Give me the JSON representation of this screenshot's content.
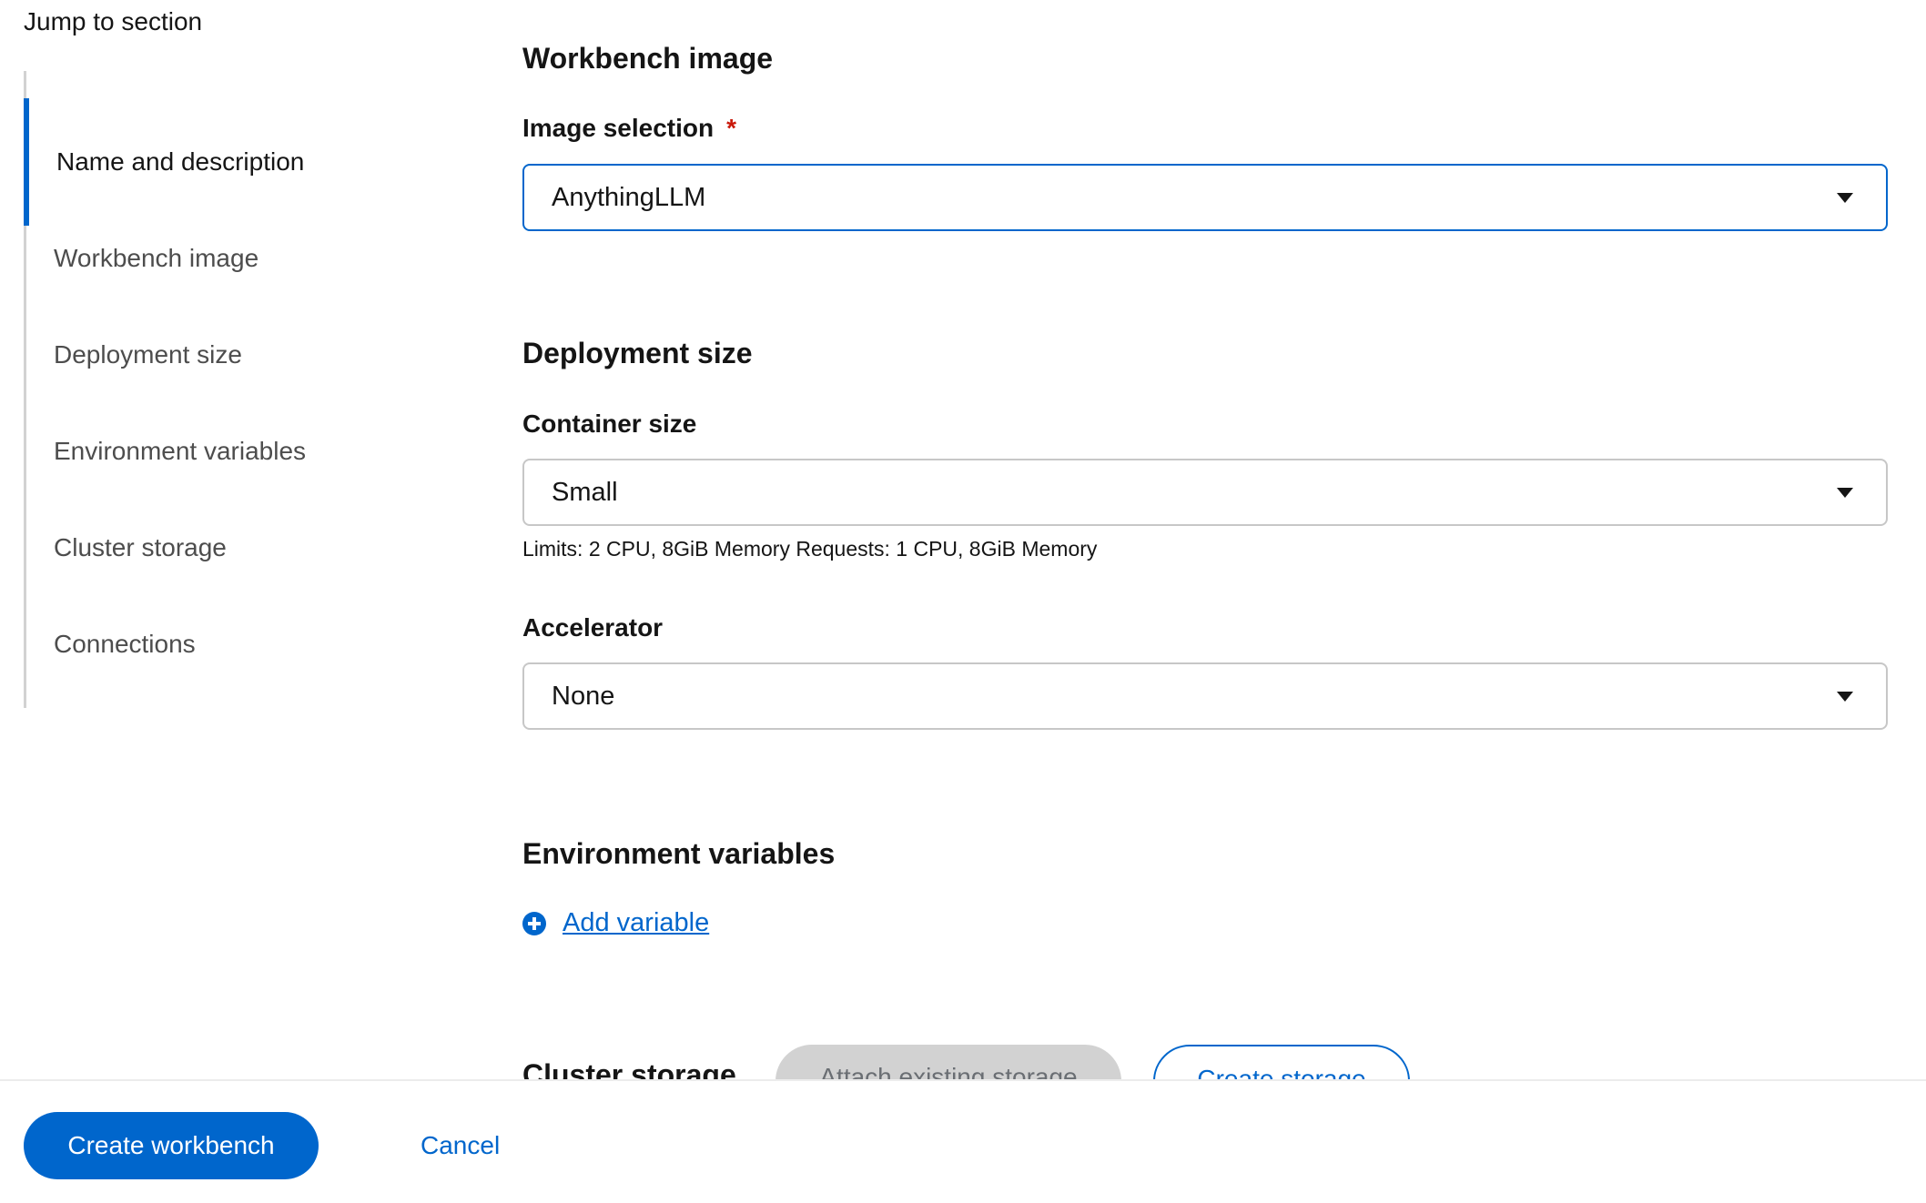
{
  "jump": {
    "title": "Jump to section",
    "items": [
      {
        "label": "Name and description",
        "active": true
      },
      {
        "label": "Workbench image"
      },
      {
        "label": "Deployment size"
      },
      {
        "label": "Environment variables"
      },
      {
        "label": "Cluster storage"
      },
      {
        "label": "Connections"
      }
    ]
  },
  "workbench_image": {
    "title": "Workbench image",
    "image_label": "Image selection",
    "required_marker": "*",
    "image_value": "AnythingLLM"
  },
  "deployment": {
    "title": "Deployment size",
    "container_label": "Container size",
    "container_value": "Small",
    "container_helper": "Limits: 2 CPU, 8GiB Memory Requests: 1 CPU, 8GiB Memory",
    "accelerator_label": "Accelerator",
    "accelerator_value": "None"
  },
  "env": {
    "title": "Environment variables",
    "add_label": "Add variable"
  },
  "storage": {
    "title": "Cluster storage",
    "attach_label": "Attach existing storage",
    "create_label": "Create storage"
  },
  "footer": {
    "create_label": "Create workbench",
    "cancel_label": "Cancel"
  },
  "colors": {
    "accent": "#0066cc",
    "required": "#c9190b",
    "disabled": "#d2d2d2"
  }
}
